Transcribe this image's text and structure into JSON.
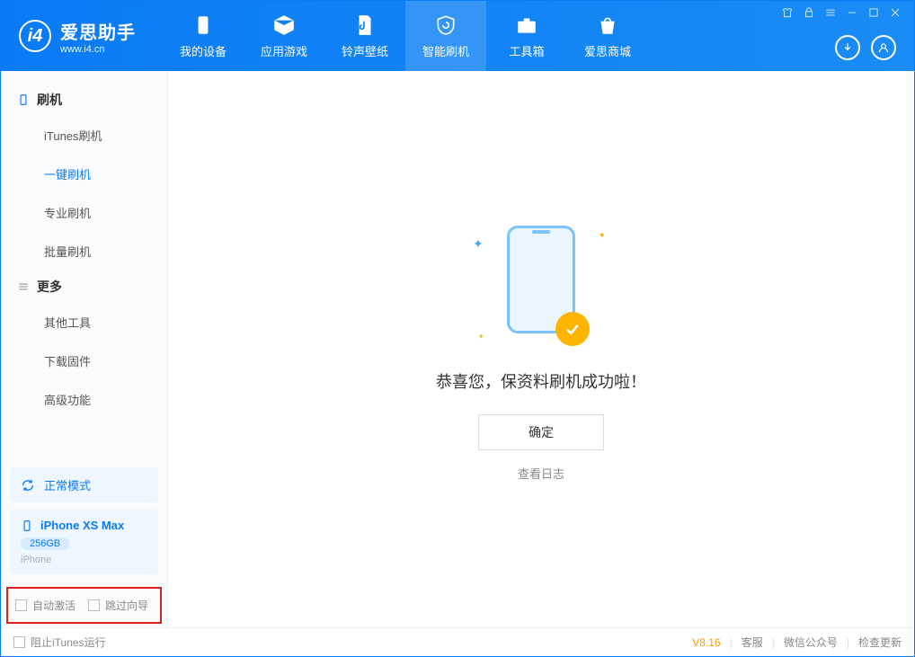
{
  "app": {
    "title": "爱思助手",
    "url": "www.i4.cn"
  },
  "nav": {
    "tabs": [
      {
        "label": "我的设备"
      },
      {
        "label": "应用游戏"
      },
      {
        "label": "铃声壁纸"
      },
      {
        "label": "智能刷机"
      },
      {
        "label": "工具箱"
      },
      {
        "label": "爱思商城"
      }
    ]
  },
  "sidebar": {
    "section_flash": "刷机",
    "items_flash": [
      "iTunes刷机",
      "一键刷机",
      "专业刷机",
      "批量刷机"
    ],
    "section_more": "更多",
    "items_more": [
      "其他工具",
      "下载固件",
      "高级功能"
    ],
    "mode_box": "正常模式",
    "device": {
      "name": "iPhone XS Max",
      "capacity": "256GB",
      "type": "iPhone"
    },
    "auto_activate": "自动激活",
    "skip_guide": "跳过向导"
  },
  "main": {
    "success_text": "恭喜您，保资料刷机成功啦！",
    "ok_button": "确定",
    "view_log": "查看日志"
  },
  "footer": {
    "block_itunes": "阻止iTunes运行",
    "version": "V8.16",
    "support": "客服",
    "wechat": "微信公众号",
    "update": "检查更新"
  }
}
